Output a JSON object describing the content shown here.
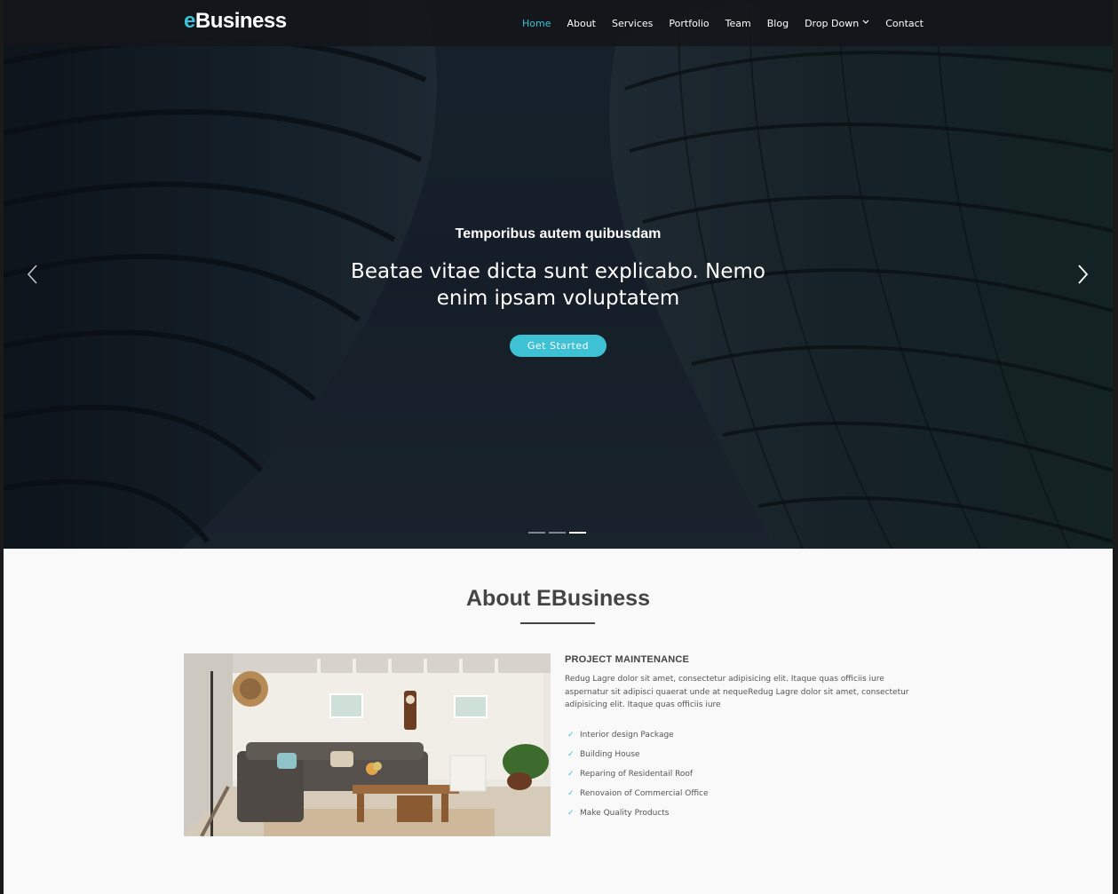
{
  "brand": {
    "prefix": "e",
    "rest": "Business",
    "accent_color": "#3ec1d5"
  },
  "nav": {
    "items": [
      {
        "label": "Home",
        "active": true
      },
      {
        "label": "About"
      },
      {
        "label": "Services"
      },
      {
        "label": "Portfolio"
      },
      {
        "label": "Team"
      },
      {
        "label": "Blog"
      },
      {
        "label": "Drop Down",
        "dropdown": true
      },
      {
        "label": "Contact"
      }
    ]
  },
  "hero": {
    "subtitle": "Temporibus autem quibusdam",
    "title": "Beatae vitae dicta sunt explicabo. Nemo enim ipsam voluptatem",
    "cta_label": "Get Started",
    "prev_icon": "chevron-left-icon",
    "next_icon": "chevron-right-icon",
    "slides": 3,
    "active_slide": 3
  },
  "about": {
    "title": "About EBusiness",
    "heading": "PROJECT MAINTENANCE",
    "paragraph": "Redug Lagre dolor sit amet, consectetur adipisicing elit. Itaque quas officiis iure aspernatur sit adipisci quaerat unde at nequeRedug Lagre dolor sit amet, consectetur adipisicing elit. Itaque quas officiis iure",
    "features": [
      "Interior design Package",
      "Building House",
      "Reparing of Residentail Roof",
      "Renovaion of Commercial Office",
      "Make Quality Products"
    ],
    "check_icon": "check-icon"
  }
}
